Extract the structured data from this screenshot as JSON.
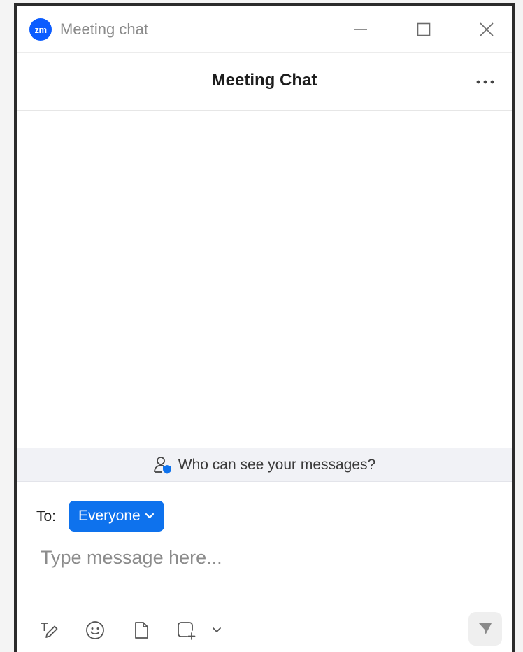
{
  "window": {
    "title": "Meeting chat",
    "logo_text": "zm"
  },
  "header": {
    "title": "Meeting Chat"
  },
  "banner": {
    "text": "Who can see your messages?"
  },
  "composer": {
    "to_label": "To:",
    "recipient": "Everyone",
    "placeholder": "Type message here...",
    "value": ""
  },
  "icons": {
    "logo": "zoom-logo-icon",
    "minimize": "minimize-icon",
    "maximize": "maximize-icon",
    "close": "close-icon",
    "more": "more-horizontal-icon",
    "visibility": "person-shield-icon",
    "dropdown": "chevron-down-icon",
    "format": "text-format-icon",
    "emoji": "emoji-icon",
    "file": "file-icon",
    "screenshot": "screenshot-icon",
    "send": "send-icon"
  },
  "colors": {
    "brand": "#0b5cff",
    "recipient_button": "#0e72ed",
    "banner_bg": "#f1f2f6",
    "send_button_bg": "#efefef"
  }
}
